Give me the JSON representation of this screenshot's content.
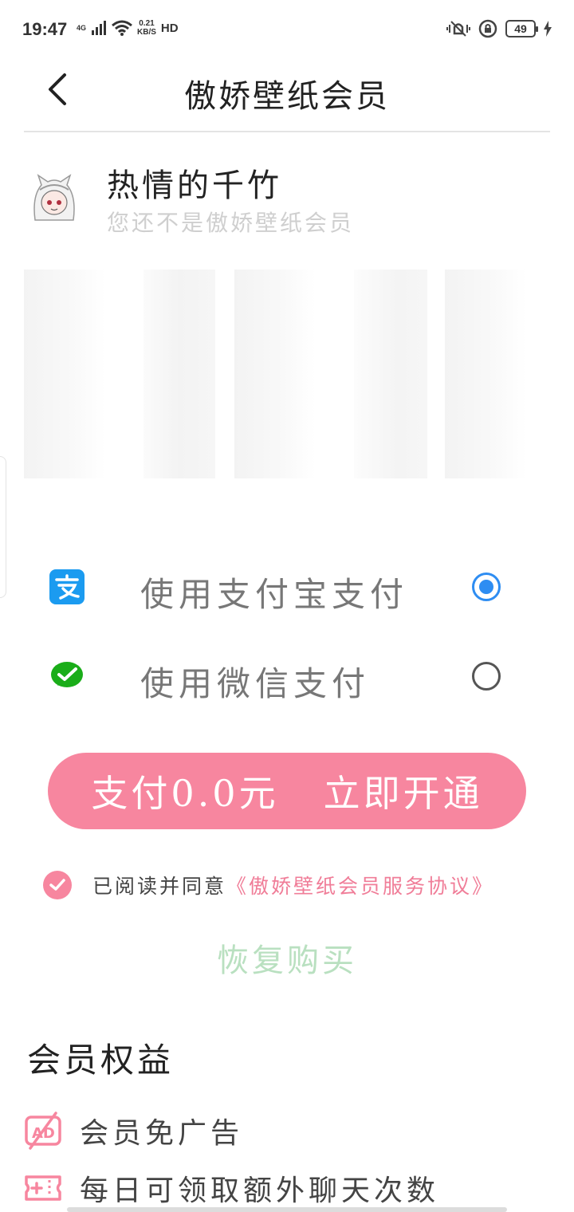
{
  "status_bar": {
    "time": "19:47",
    "network": "4G",
    "speed_value": "0.21",
    "speed_unit": "KB/S",
    "hd": "HD",
    "battery": "49"
  },
  "header": {
    "title": "傲娇壁纸会员"
  },
  "user": {
    "name": "热情的千竹",
    "status": "您还不是傲娇壁纸会员"
  },
  "payment": {
    "options": [
      {
        "label": "使用支付宝支付",
        "icon": "alipay-icon",
        "selected": true
      },
      {
        "label": "使用微信支付",
        "icon": "wechat-icon",
        "selected": false
      }
    ],
    "button_price": "支付0.0元",
    "button_action": "立即开通"
  },
  "agreement": {
    "text": "已阅读并同意",
    "link": "《傲娇壁纸会员服务协议》",
    "checked": true
  },
  "restore_label": "恢复购买",
  "benefits": {
    "title": "会员权益",
    "items": [
      {
        "label": "会员免广告",
        "icon": "no-ads-icon"
      },
      {
        "label": "每日可领取额外聊天次数",
        "icon": "ticket-icon"
      }
    ]
  },
  "colors": {
    "accent_pink": "#f7869f",
    "radio_blue": "#2e8df2",
    "alipay_blue": "#1b9bf0",
    "wechat_green": "#1aad19",
    "restore_green": "#b9e0c0"
  }
}
